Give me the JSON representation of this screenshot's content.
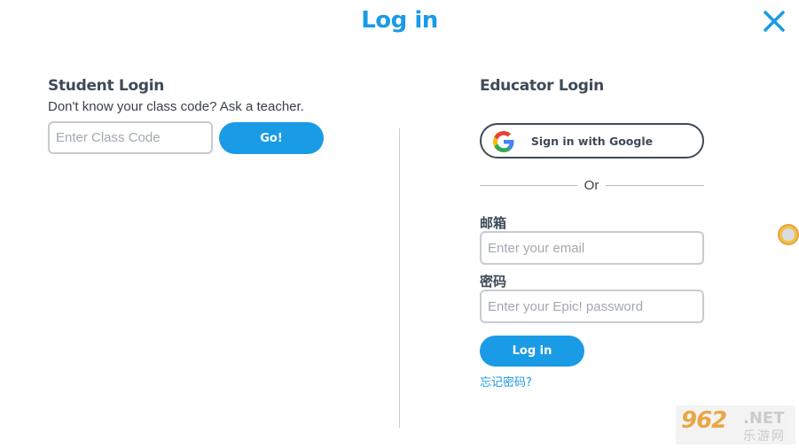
{
  "header": {
    "title": "Log in"
  },
  "student": {
    "title": "Student Login",
    "hint": "Don't know your class code? Ask a teacher.",
    "class_code_placeholder": "Enter Class Code",
    "go_label": "Go!"
  },
  "educator": {
    "title": "Educator Login",
    "google_label": "Sign in with Google",
    "or_label": "Or",
    "email_label": "邮箱",
    "email_placeholder": "Enter your email",
    "password_label": "密码",
    "password_placeholder": "Enter your Epic! password",
    "login_label": "Log in",
    "forgot_label": "忘记密码?"
  },
  "watermark": {
    "number": "962",
    "suffix": ".NET",
    "cn": "乐游网"
  },
  "colors": {
    "accent": "#1a9be6",
    "text_dark": "#3e4a59",
    "border": "#c7cbd1"
  },
  "icons": [
    "close-icon",
    "google-logo-icon"
  ]
}
